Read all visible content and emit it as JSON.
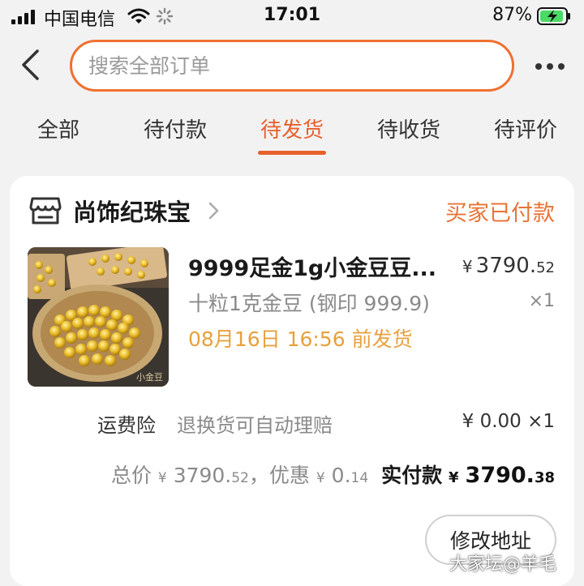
{
  "status_bar": {
    "carrier": "中国电信",
    "time": "17:01",
    "battery": "87%"
  },
  "search": {
    "placeholder": "搜索全部订单"
  },
  "tabs": [
    {
      "label": "全部",
      "active": false
    },
    {
      "label": "待付款",
      "active": false
    },
    {
      "label": "待发货",
      "active": true
    },
    {
      "label": "待收货",
      "active": false
    },
    {
      "label": "待评价",
      "active": false
    }
  ],
  "order": {
    "store_name": "尚饰纪珠宝",
    "status": "买家已付款",
    "product": {
      "title": "9999足金1g小金豆豆...",
      "price_symbol": "¥",
      "price_main": "3790.",
      "price_cents": "52",
      "spec": "十粒1克金豆 (钢印 999.9)",
      "quantity": "×1",
      "ship_deadline": "08月16日 16:56 前发货",
      "image_caption": "小金豆"
    },
    "insurance": {
      "label": "运费险",
      "description": "退换货可自动理赔",
      "price": "¥ 0.00 ×1"
    },
    "totals": {
      "total_label": "总价",
      "total_symbol": "¥",
      "total_main": "3790.",
      "total_cents": "52",
      "separator": "，",
      "discount_label": "优惠",
      "discount_symbol": "¥",
      "discount_main": "0.",
      "discount_cents": "14",
      "paid_label": "实付款",
      "paid_symbol": "¥",
      "paid_main": "3790.",
      "paid_cents": "38"
    },
    "modify_address_label": "修改地址"
  },
  "watermark": "大家坛@羊毛",
  "colors": {
    "accent": "#e8602b",
    "status": "#e87436",
    "deadline": "#e8a03c",
    "background": "#f2f2f2"
  },
  "icons": [
    "signal-icon",
    "wifi-icon",
    "loading-spinner-icon",
    "battery-charging-icon",
    "back-arrow-icon",
    "more-icon",
    "store-icon",
    "chevron-right-icon"
  ]
}
